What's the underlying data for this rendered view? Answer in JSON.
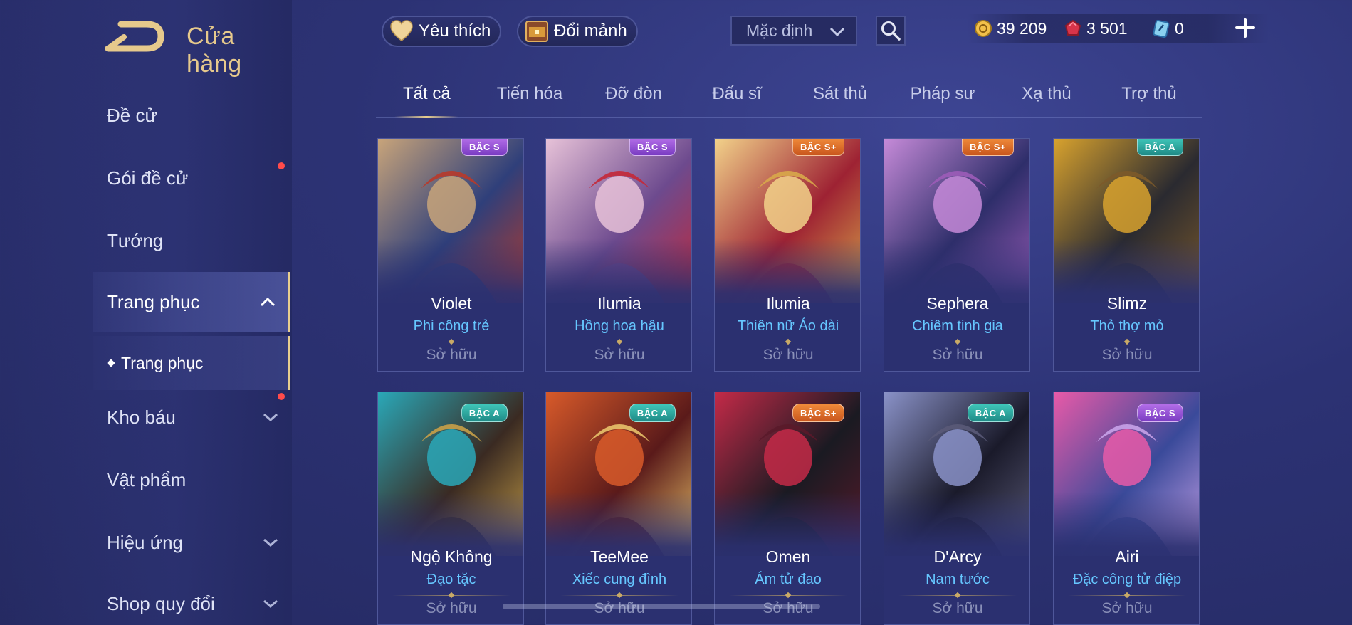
{
  "header": {
    "title": "Cửa hàng",
    "favorites_label": "Yêu thích",
    "exchange_label": "Đổi mảnh",
    "sort_value": "Mặc định",
    "currencies": [
      {
        "icon": "gold-coin-icon",
        "value": "39 209"
      },
      {
        "icon": "red-gem-icon",
        "value": "3 501"
      },
      {
        "icon": "blue-ticket-icon",
        "value": "0"
      }
    ]
  },
  "sidebar": {
    "items": [
      {
        "label": "Đề cử"
      },
      {
        "label": "Gói đề cử"
      },
      {
        "label": "Tướng"
      },
      {
        "label": "Trang phục"
      },
      {
        "label": "Trang phục"
      },
      {
        "label": "Kho báu"
      },
      {
        "label": "Vật phẩm"
      },
      {
        "label": "Hiệu ứng"
      },
      {
        "label": "Shop quy đổi"
      }
    ]
  },
  "tabs": [
    "Tất cả",
    "Tiến hóa",
    "Đỡ đòn",
    "Đấu sĩ",
    "Sát thủ",
    "Pháp sư",
    "Xạ thủ",
    "Trợ thủ"
  ],
  "cards": [
    {
      "hero": "Violet",
      "skin": "Phi công trẻ",
      "status": "Sở hữu",
      "tier": "BẬC S",
      "colors": [
        "#c8a47a",
        "#2f3f7a",
        "#b83a2a"
      ]
    },
    {
      "hero": "Ilumia",
      "skin": "Hồng hoa hậu",
      "status": "Sở hữu",
      "tier": "BẬC S",
      "colors": [
        "#e7c2d8",
        "#6d4a8e",
        "#c42837"
      ]
    },
    {
      "hero": "Ilumia",
      "skin": "Thiên nữ Áo dài",
      "status": "Sở hữu",
      "tier": "BẬC S+",
      "colors": [
        "#f2d28a",
        "#9e2233",
        "#d8a84a"
      ]
    },
    {
      "hero": "Sephera",
      "skin": "Chiêm tinh gia",
      "status": "Sở hữu",
      "tier": "BẬC S+",
      "colors": [
        "#c58ad8",
        "#2e2e6a",
        "#9c5cb8"
      ]
    },
    {
      "hero": "Slimz",
      "skin": "Thỏ thợ mỏ",
      "status": "Sở hữu",
      "tier": "BẬC A",
      "colors": [
        "#d8a22e",
        "#2a2a30",
        "#7c5a2a"
      ]
    },
    {
      "hero": "Ngộ Không",
      "skin": "Đạo tặc",
      "status": "Sở hữu",
      "tier": "BẬC A",
      "colors": [
        "#2aa8b8",
        "#3a2a22",
        "#c8a048"
      ]
    },
    {
      "hero": "TeeMee",
      "skin": "Xiếc cung đình",
      "status": "Sở hữu",
      "tier": "BẬC A",
      "colors": [
        "#d85a2a",
        "#5a1a1a",
        "#e8c26a"
      ]
    },
    {
      "hero": "Omen",
      "skin": "Ám tử đao",
      "status": "Sở hữu",
      "tier": "BẬC S+",
      "colors": [
        "#c42a48",
        "#1a1a22",
        "#5a1a2a"
      ]
    },
    {
      "hero": "D'Arcy",
      "skin": "Nam tước",
      "status": "Sở hữu",
      "tier": "BẬC A",
      "colors": [
        "#8a92c8",
        "#1a1a2a",
        "#5a5a78"
      ]
    },
    {
      "hero": "Airi",
      "skin": "Đặc công tử điệp",
      "status": "Sở hữu",
      "tier": "BẬC S",
      "colors": [
        "#e85aa8",
        "#3a4a9a",
        "#c8a2e8"
      ]
    }
  ]
}
